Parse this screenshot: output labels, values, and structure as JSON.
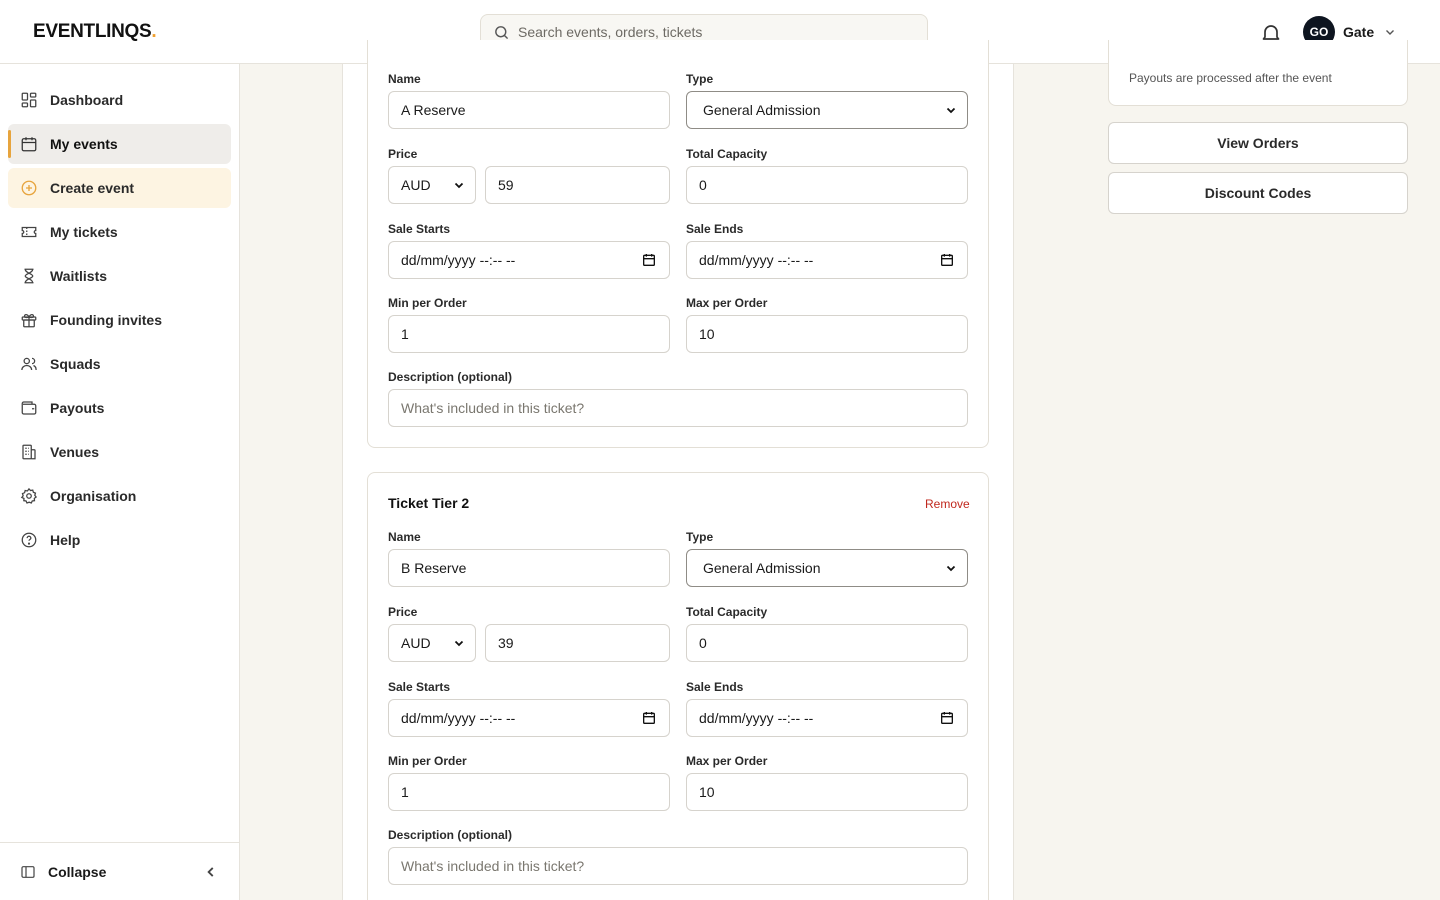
{
  "brand": {
    "name": "EVENTLINQS",
    "dot": "."
  },
  "search": {
    "placeholder": "Search events, orders, tickets"
  },
  "user": {
    "initials": "GO",
    "name": "Gate"
  },
  "sidebar": {
    "items": [
      {
        "label": "Dashboard",
        "icon": "dashboard-icon"
      },
      {
        "label": "My events",
        "icon": "calendar-icon"
      },
      {
        "label": "Create event",
        "icon": "plus-circle-icon"
      },
      {
        "label": "My tickets",
        "icon": "ticket-icon"
      },
      {
        "label": "Waitlists",
        "icon": "hourglass-icon"
      },
      {
        "label": "Founding invites",
        "icon": "gift-icon"
      },
      {
        "label": "Squads",
        "icon": "users-icon"
      },
      {
        "label": "Payouts",
        "icon": "wallet-icon"
      },
      {
        "label": "Venues",
        "icon": "building-icon"
      },
      {
        "label": "Organisation",
        "icon": "gear-icon"
      },
      {
        "label": "Help",
        "icon": "help-icon"
      }
    ],
    "active": "My events",
    "collapse_label": "Collapse"
  },
  "labels": {
    "name": "Name",
    "type": "Type",
    "price": "Price",
    "total_capacity": "Total Capacity",
    "sale_starts": "Sale Starts",
    "sale_ends": "Sale Ends",
    "min_per_order": "Min per Order",
    "max_per_order": "Max per Order",
    "description": "Description (optional)",
    "description_placeholder": "What's included in this ticket?",
    "date_placeholder": "dd/mm/yyyy --:-- --",
    "remove": "Remove"
  },
  "tiers": [
    {
      "title": "",
      "name": "A Reserve",
      "type": "General Admission",
      "currency": "AUD",
      "price": "59",
      "capacity": "0",
      "min": "1",
      "max": "10"
    },
    {
      "title": "Ticket Tier 2",
      "name": "B Reserve",
      "type": "General Admission",
      "currency": "AUD",
      "price": "39",
      "capacity": "0",
      "min": "1",
      "max": "10"
    }
  ],
  "right": {
    "payout_note": "Payouts are processed after the event",
    "view_orders": "View Orders",
    "discount_codes": "Discount Codes"
  },
  "colors": {
    "accent": "#e7a43d",
    "danger": "#c0281e",
    "avatar": "#0e1520"
  }
}
